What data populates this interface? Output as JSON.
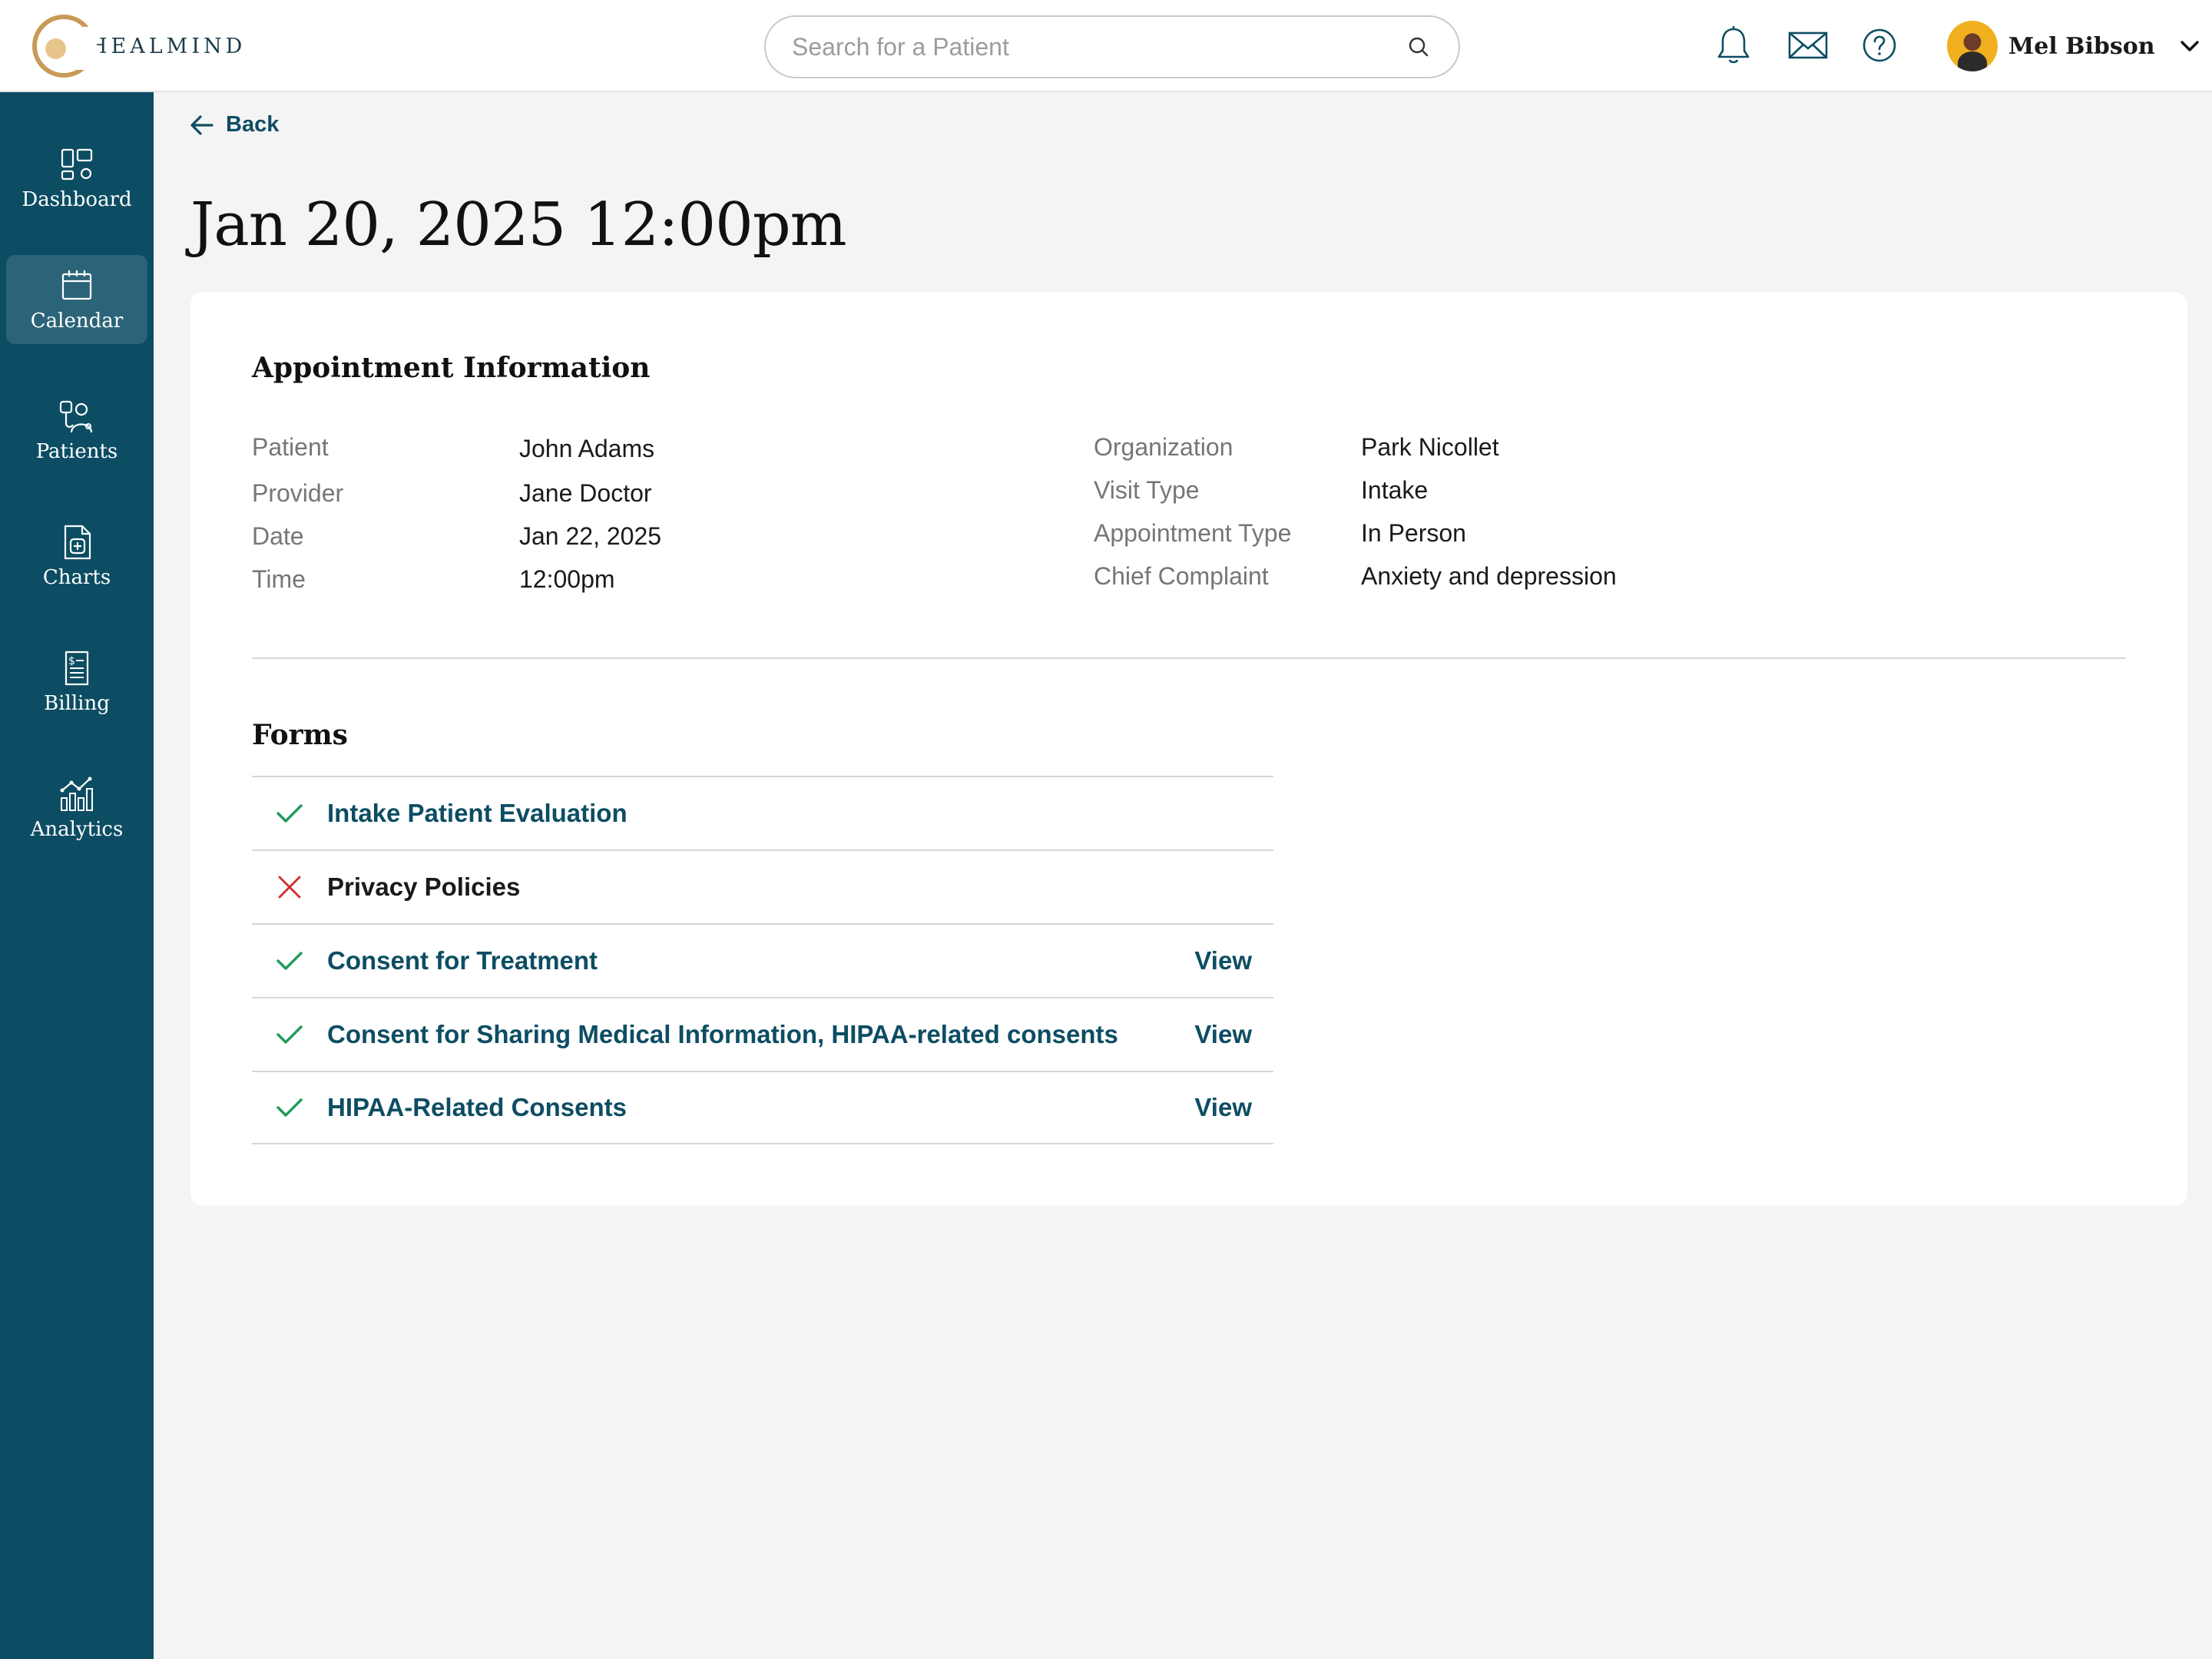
{
  "app": {
    "logo_text": "HEALMIND"
  },
  "search": {
    "placeholder": "Search for a Patient"
  },
  "user": {
    "name": "Mel Bibson"
  },
  "colors": {
    "brand": "#0d4d63",
    "success": "#1f9a5a",
    "error": "#d22a2a",
    "gold": "#c79a55"
  },
  "sidebar": {
    "items": [
      {
        "label": "Dashboard",
        "icon": "dashboard-icon",
        "active": false
      },
      {
        "label": "Calendar",
        "icon": "calendar-icon",
        "active": true
      },
      {
        "label": "Patients",
        "icon": "patients-icon",
        "active": false
      },
      {
        "label": "Charts",
        "icon": "charts-icon",
        "active": false
      },
      {
        "label": "Billing",
        "icon": "billing-icon",
        "active": false
      },
      {
        "label": "Analytics",
        "icon": "analytics-icon",
        "active": false
      }
    ]
  },
  "page": {
    "back_label": "Back",
    "title": "Jan 20, 2025 12:00pm"
  },
  "appointment": {
    "section_title": "Appointment Information",
    "left": [
      {
        "label": "Patient",
        "value": "John Adams"
      },
      {
        "label": "Provider",
        "value": "Jane Doctor"
      },
      {
        "label": "Date",
        "value": "Jan 22, 2025"
      },
      {
        "label": "Time",
        "value": "12:00pm"
      }
    ],
    "right": [
      {
        "label": "Organization",
        "value": "Park Nicollet"
      },
      {
        "label": "Visit Type",
        "value": "Intake"
      },
      {
        "label": "Appointment Type",
        "value": "In Person"
      },
      {
        "label": "Chief Complaint",
        "value": "Anxiety and depression"
      }
    ]
  },
  "forms": {
    "section_title": "Forms",
    "items": [
      {
        "name": "Intake Patient Evaluation",
        "status": "complete",
        "action": ""
      },
      {
        "name": "Privacy Policies",
        "status": "incomplete",
        "action": ""
      },
      {
        "name": "Consent for Treatment",
        "status": "complete",
        "action": "View"
      },
      {
        "name": "Consent for Sharing Medical Information, HIPAA-related consents",
        "status": "complete",
        "action": "View"
      },
      {
        "name": "HIPAA-Related Consents",
        "status": "complete",
        "action": "View"
      }
    ]
  }
}
